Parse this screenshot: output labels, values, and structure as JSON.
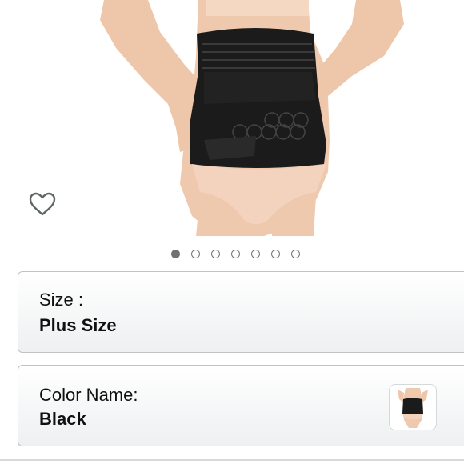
{
  "product": {
    "image_alt": "Black postpartum belly wrap worn by model",
    "wishlist_icon": "heart-outline-icon"
  },
  "carousel": {
    "total": 7,
    "active_index": 0
  },
  "options": {
    "size": {
      "label": "Size :",
      "value": "Plus Size"
    },
    "color": {
      "label": "Color Name:",
      "value": "Black"
    }
  },
  "colors": {
    "accent_text": "#0f1111",
    "dot_color": "#6f7373",
    "card_border": "#bfc3c4",
    "wrap_black": "#1a1a1a",
    "skin": "#f0cdb4"
  }
}
